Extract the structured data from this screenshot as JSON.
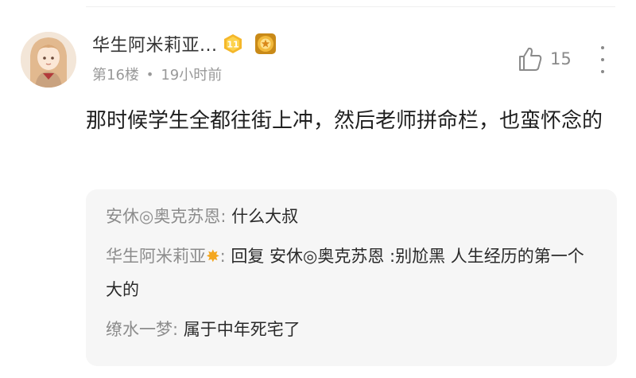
{
  "comment": {
    "username": "华生阿米莉亚...",
    "level_badge": "11",
    "floor": "第16楼",
    "separator": "•",
    "time": "19小时前",
    "like_count": "15",
    "text": "那时候学生全都往街上冲，然后老师拼命栏，也蛮怀念的"
  },
  "replies": [
    {
      "author": "安休◎奥克苏恩",
      "colon": ": ",
      "text": "什么大叔"
    },
    {
      "author": "华生阿米莉亚",
      "author_icon": "star-badge-icon",
      "colon": ": ",
      "text": "回复 安休◎奥克苏恩 :别尬黑 人生经历的第一个大的"
    },
    {
      "author": "缭水一梦",
      "colon": ": ",
      "text": "属于中年死宅了"
    }
  ],
  "colors": {
    "level_badge": "#f5b72a",
    "medal_badge": "#e39a1c",
    "secondary_text": "#999999",
    "reply_bg": "#f6f6f6"
  }
}
